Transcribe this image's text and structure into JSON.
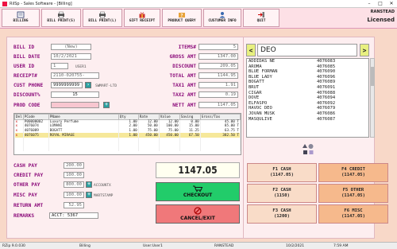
{
  "window": {
    "title": "RilSp - Sales Software - [Billing]"
  },
  "brand": {
    "line1": "RANSTEAD",
    "line2": "Licensed"
  },
  "toolbar": [
    {
      "label": "BILLING",
      "icon": "billing-icon"
    },
    {
      "label": "BILL PRINT(S)",
      "icon": "printer-icon"
    },
    {
      "label": "BILL PRINT(L)",
      "icon": "printer-icon"
    },
    {
      "label": "GIFT RECEIPT",
      "icon": "gift-icon"
    },
    {
      "label": "PRODUCT QUERY",
      "icon": "query-icon"
    },
    {
      "label": "CUSTOMER INFO",
      "icon": "customer-icon"
    },
    {
      "label": "QUIT",
      "icon": "quit-icon"
    }
  ],
  "form": {
    "bill_id": {
      "label": "BILL ID",
      "value": "(New)"
    },
    "bill_date": {
      "label": "BILL DATE",
      "value": "10/2/2021"
    },
    "user_id": {
      "label": "USER ID",
      "value": "1",
      "side": "USER1"
    },
    "receipt": {
      "label": "RECEIPT#",
      "value": "2110-020755-"
    },
    "cust_phone": {
      "label": "CUST PHONE",
      "value": "9999999999",
      "side": "SWMART-LTD"
    },
    "discount_pct": {
      "label": "DISCOUNT%",
      "value": "15"
    },
    "prod_code": {
      "label": "PROD CODE",
      "value": ""
    }
  },
  "summary": {
    "items": {
      "label": "ITEMS#",
      "value": "5"
    },
    "gross": {
      "label": "GROSS AMT",
      "value": "1347.00"
    },
    "discount": {
      "label": "DISCOUNT",
      "value": "209.05"
    },
    "total": {
      "label": "TOTAL AMT",
      "value": "1144.95"
    },
    "tax1": {
      "label": "TAX1 AMT",
      "value": "1.91"
    },
    "tax2": {
      "label": "TAX2 AMT",
      "value": "0.19"
    },
    "nett": {
      "label": "NETT AMT",
      "value": "1147.05"
    }
  },
  "grid": {
    "headers": [
      "Del",
      "PCode",
      "PName",
      "Qty",
      "Rate",
      "Value",
      "Saving",
      "Gross/Tax"
    ],
    "rows": [
      [
        "x",
        "P00000002",
        "Luxury Perfume",
        "1.00",
        "12.00",
        "12.00",
        "0.00",
        "45.00 T"
      ],
      [
        "x",
        "4076074",
        "LOMANI",
        "2.00",
        "50.00",
        "100.00",
        "15.00",
        "85.00 T"
      ],
      [
        "x",
        "4076089",
        "BOGATT",
        "1.00",
        "75.00",
        "75.00",
        "11.25",
        "63.75 T"
      ],
      [
        "x",
        "4076075",
        "ROYAL MIRAGE",
        "1.00",
        "450.00",
        "450.00",
        "67.50",
        "382.50 T"
      ]
    ]
  },
  "payments": {
    "cash": {
      "label": "CASH PAY",
      "value": "200.00"
    },
    "credit": {
      "label": "CREDIT PAY",
      "value": "100.00"
    },
    "other": {
      "label": "OTHER PAY",
      "value": "800.00",
      "side": "ACCOUNTX"
    },
    "misc": {
      "label": "MISC PAY",
      "value": "100.00",
      "side": "MARTSTAMP"
    },
    "return": {
      "label": "RETURN AMT",
      "value": "52.95"
    },
    "remarks": {
      "label": "REMARKS",
      "value": "ACCT: 5367"
    }
  },
  "grand_total": "1147.05",
  "buttons": {
    "checkout": "CHECKOUT",
    "cancel": "CANCEL/EXIT"
  },
  "search": {
    "value": "DEO",
    "prev": "<",
    "next": ">"
  },
  "products": [
    {
      "name": "ADDIDAS NE",
      "code": "4076083"
    },
    {
      "name": "AROMA",
      "code": "4076085"
    },
    {
      "name": "BLUE FORMAN",
      "code": "4076090"
    },
    {
      "name": "BLUE LADY",
      "code": "4076096"
    },
    {
      "name": "BOGATT",
      "code": "4076089"
    },
    {
      "name": "BRUT",
      "code": "4076091"
    },
    {
      "name": "CIGAR",
      "code": "4076088"
    },
    {
      "name": "DOVE",
      "code": "4076094"
    },
    {
      "name": "ELFASPO",
      "code": "4076092"
    },
    {
      "name": "HAVOC DEO",
      "code": "4076079"
    },
    {
      "name": "JOVAN MUSK",
      "code": "4076086"
    },
    {
      "name": "MASQULIVE",
      "code": "4076087"
    }
  ],
  "fkeys": [
    {
      "key": "F1 CASH",
      "amt": "(1147.05)",
      "color": "#f9dcc8"
    },
    {
      "key": "F4 CREDIT",
      "amt": "(1147.05)",
      "color": "#f6b98c"
    },
    {
      "key": "F2 CASH",
      "amt": "(1150)",
      "color": "#f9dcc8"
    },
    {
      "key": "F5 OTHER",
      "amt": "(1147.05)",
      "color": "#f6b98c"
    },
    {
      "key": "F3 CASH",
      "amt": "(1200)",
      "color": "#f9dcc8"
    },
    {
      "key": "F6 MISC",
      "amt": "(1147.05)",
      "color": "#f6b98c"
    }
  ],
  "status": {
    "version": "RZip 9.0.030",
    "module": "Billing",
    "user": "User:User1",
    "store": "RANSTEAD",
    "date": "10/2/2021",
    "time": "7:59 AM"
  }
}
